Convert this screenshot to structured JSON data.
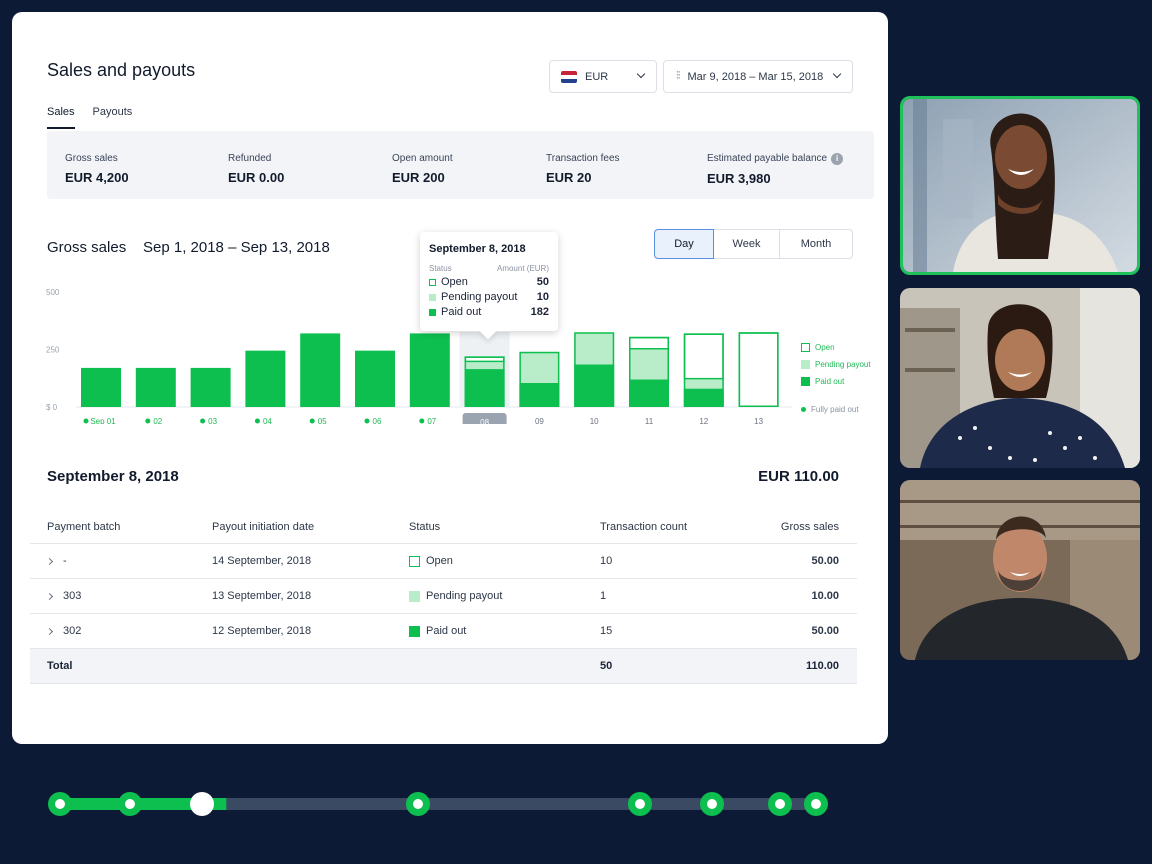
{
  "app": {
    "title": "Sales and payouts",
    "currency": "EUR",
    "date_range": "Mar 9, 2018 – Mar 15, 2018",
    "tabs": [
      {
        "label": "Sales",
        "active": true
      },
      {
        "label": "Payouts",
        "active": false
      }
    ]
  },
  "summary": [
    {
      "label": "Gross sales",
      "value": "EUR 4,200"
    },
    {
      "label": "Refunded",
      "value": "EUR 0.00"
    },
    {
      "label": "Open amount",
      "value": "EUR 200"
    },
    {
      "label": "Transaction fees",
      "value": "EUR 20"
    },
    {
      "label": "Estimated payable balance",
      "value": "EUR 3,980",
      "info_icon": "info-icon"
    }
  ],
  "gross": {
    "title": "Gross sales",
    "range": "Sep 1, 2018 – Sep 13, 2018",
    "granularity": [
      "Day",
      "Week",
      "Month"
    ],
    "active_granularity": "Day"
  },
  "colors": {
    "paid": "#0dbf4f",
    "pending": "#b9ecc9",
    "open_border": "#0dbf4f",
    "selected_tick": "#9aa3b0",
    "dark_bg": "#0c1a35"
  },
  "chart_data": {
    "type": "bar",
    "stacked": true,
    "ylim": [
      0,
      500
    ],
    "yticks": [
      {
        "value": 500,
        "label": "500"
      },
      {
        "value": 250,
        "label": "250"
      },
      {
        "value": 0,
        "label": "$ 0"
      }
    ],
    "categories": [
      "Sep 01",
      "02",
      "03",
      "04",
      "05",
      "06",
      "07",
      "08",
      "09",
      "10",
      "11",
      "12",
      "13"
    ],
    "fully_paid": [
      true,
      true,
      true,
      true,
      true,
      true,
      true,
      false,
      false,
      false,
      false,
      false,
      false
    ],
    "selected_index": 7,
    "series": [
      {
        "name": "Paid out",
        "values": [
          170,
          170,
          170,
          245,
          320,
          245,
          320,
          165,
          105,
          185,
          120,
          80,
          0
        ]
      },
      {
        "name": "Pending payout",
        "values": [
          0,
          0,
          0,
          0,
          0,
          0,
          0,
          30,
          135,
          135,
          130,
          40,
          0
        ]
      },
      {
        "name": "Open",
        "values": [
          0,
          0,
          0,
          0,
          0,
          0,
          0,
          25,
          0,
          5,
          55,
          200,
          325
        ]
      }
    ],
    "legend": [
      "Open",
      "Pending payout",
      "Paid out"
    ],
    "legend_extra": "Fully paid out",
    "legend_position": "right",
    "grid": false
  },
  "tooltip": {
    "title": "September 8, 2018",
    "col_status": "Status",
    "col_amount": "Amount (EUR)",
    "rows": [
      {
        "label": "Open",
        "value": "50"
      },
      {
        "label": "Pending payout",
        "value": "10"
      },
      {
        "label": "Paid out",
        "value": "182"
      }
    ]
  },
  "detail": {
    "date": "September 8, 2018",
    "total": "EUR 110.00",
    "columns": [
      "Payment batch",
      "Payout initiation date",
      "Status",
      "Transaction count",
      "Gross sales"
    ],
    "rows": [
      {
        "batch": "-",
        "date": "14 September, 2018",
        "status": "Open",
        "count": "10",
        "gross": "50.00"
      },
      {
        "batch": "303",
        "date": "13 September, 2018",
        "status": "Pending payout",
        "count": "1",
        "gross": "10.00"
      },
      {
        "batch": "302",
        "date": "12 September, 2018",
        "status": "Paid out",
        "count": "15",
        "gross": "50.00"
      }
    ],
    "total_row": {
      "label": "Total",
      "count": "50",
      "gross": "110.00"
    }
  },
  "timeline": {
    "progress_fraction": 0.22,
    "current_marker": 2,
    "marker_count": 8
  }
}
